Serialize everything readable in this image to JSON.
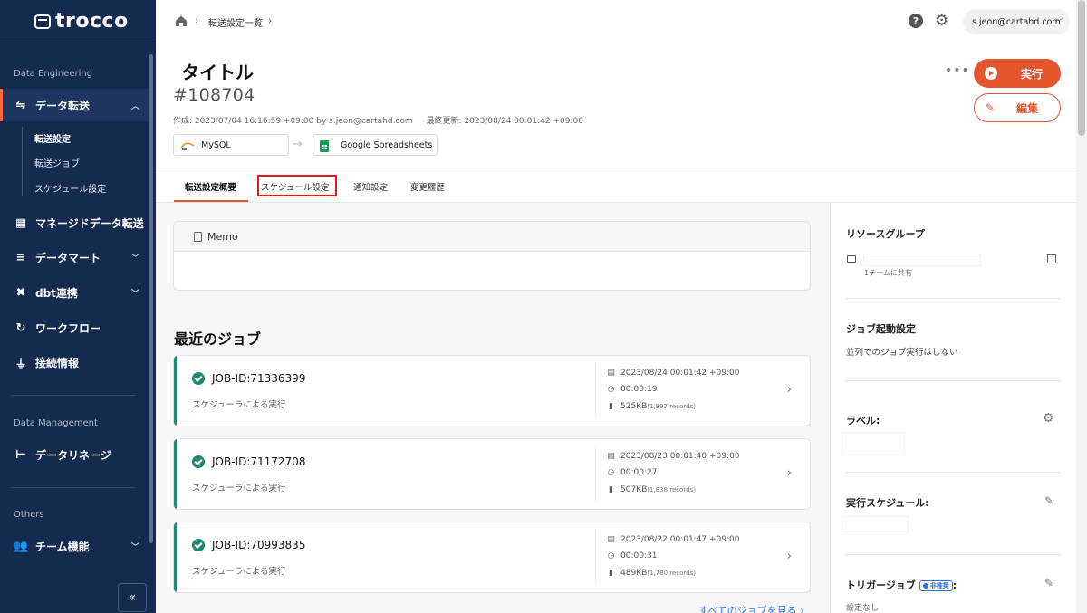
{
  "sidebar": {
    "logo": "trocco",
    "sections": {
      "data_engineering": "Data Engineering",
      "data_management": "Data Management",
      "others": "Others"
    },
    "items": {
      "data_transfer": "データ転送",
      "managed_transfer": "マネージドデータ転送",
      "datamart": "データマート",
      "dbt": "dbt連携",
      "workflow": "ワークフロー",
      "connection": "接続情報",
      "lineage": "データリネージ",
      "team": "チーム機能"
    },
    "sub_items": {
      "transfer_settings": "転送設定",
      "transfer_jobs": "転送ジョブ",
      "schedule_settings": "スケジュール設定"
    },
    "collapse_label": "«"
  },
  "topbar": {
    "breadcrumb": "転送設定一覧",
    "user_email": "s.jeon@cartahd.com"
  },
  "header": {
    "title": "タイトル",
    "id": "#108704",
    "created": "作成: 2023/07/04 16:16:59 +09:00 by s.jeon@cartahd.com",
    "updated": "最終更新: 2023/08/24 00:01:42 +09:00",
    "source": "MySQL",
    "destination": "Google Spreadsheets",
    "run_label": "実行",
    "edit_label": "編集"
  },
  "tabs": [
    "転送設定概要",
    "スケジュール設定",
    "通知設定",
    "変更履歴"
  ],
  "memo": {
    "title": "Memo"
  },
  "recent_jobs": {
    "title": "最近のジョブ",
    "see_all": "すべてのジョブを見る ›",
    "jobs": [
      {
        "name": "JOB-ID:71336399",
        "trigger": "スケジューラによる実行",
        "datetime": "2023/08/24 00:01:42 +09:00",
        "duration": "00:00:19",
        "size": "525KB",
        "records": "(1,897 records)"
      },
      {
        "name": "JOB-ID:71172708",
        "trigger": "スケジューラによる実行",
        "datetime": "2023/08/23 00:01:40 +09:00",
        "duration": "00:00:27",
        "size": "507KB",
        "records": "(1,838 records)"
      },
      {
        "name": "JOB-ID:70993835",
        "trigger": "スケジューラによる実行",
        "datetime": "2023/08/22 00:01:47 +09:00",
        "duration": "00:00:31",
        "size": "489KB",
        "records": "(1,780 records)"
      }
    ]
  },
  "right_panel": {
    "resource_group": "リソースグループ",
    "resource_shared": "1チームに共有",
    "job_start": "ジョブ起動設定",
    "job_start_value": "並列でのジョブ実行はしない",
    "label": "ラベル:",
    "schedule": "実行スケジュール:",
    "trigger": "トリガージョブ",
    "trigger_badge": "非推奨",
    "trigger_colon": ":",
    "trigger_value": "設定なし"
  },
  "colors": {
    "accent": "#e4572e",
    "sidebar": "#142a4f",
    "success": "#1f8a70",
    "link": "#2e6fd8"
  }
}
